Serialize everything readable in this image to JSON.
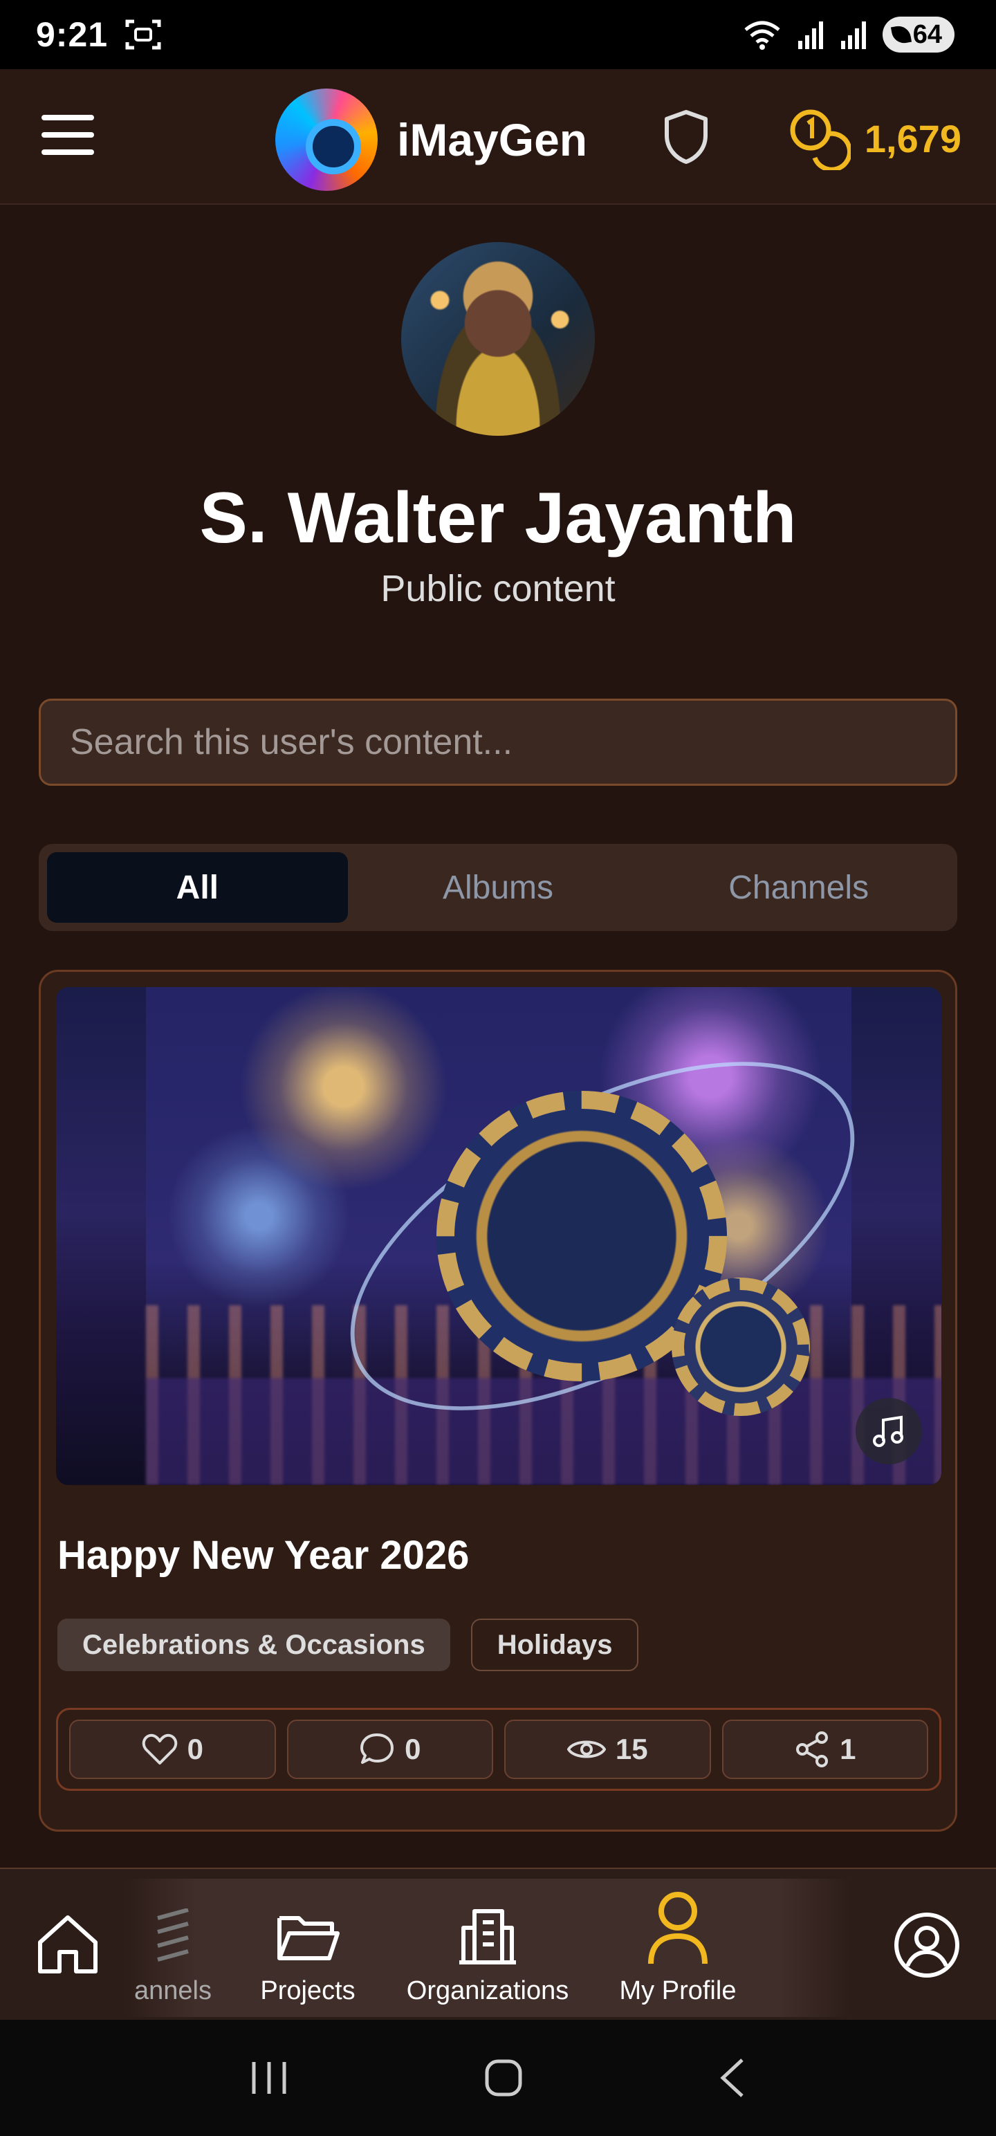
{
  "status_bar": {
    "time": "9:21",
    "battery": "64"
  },
  "header": {
    "app_name": "iMayGen",
    "coins": "1,679",
    "coin_color": "#f1b81f"
  },
  "profile": {
    "name": "S. Walter Jayanth",
    "subtitle": "Public content"
  },
  "search": {
    "placeholder": "Search this user's content..."
  },
  "tabs": [
    {
      "label": "All",
      "active": true
    },
    {
      "label": "Albums",
      "active": false
    },
    {
      "label": "Channels",
      "active": false
    }
  ],
  "card": {
    "title": "Happy New Year 2026",
    "tags": [
      "Celebrations & Occasions",
      "Holidays"
    ],
    "stats": {
      "likes": "0",
      "comments": "0",
      "views": "15",
      "shares": "1"
    }
  },
  "bottom_nav": {
    "items": [
      {
        "label": "annels",
        "icon": "channels-icon"
      },
      {
        "label": "Projects",
        "icon": "folder-icon"
      },
      {
        "label": "Organizations",
        "icon": "building-icon"
      },
      {
        "label": "My Profile",
        "icon": "user-icon",
        "active": true
      }
    ],
    "active_color": "#f1b81f"
  }
}
